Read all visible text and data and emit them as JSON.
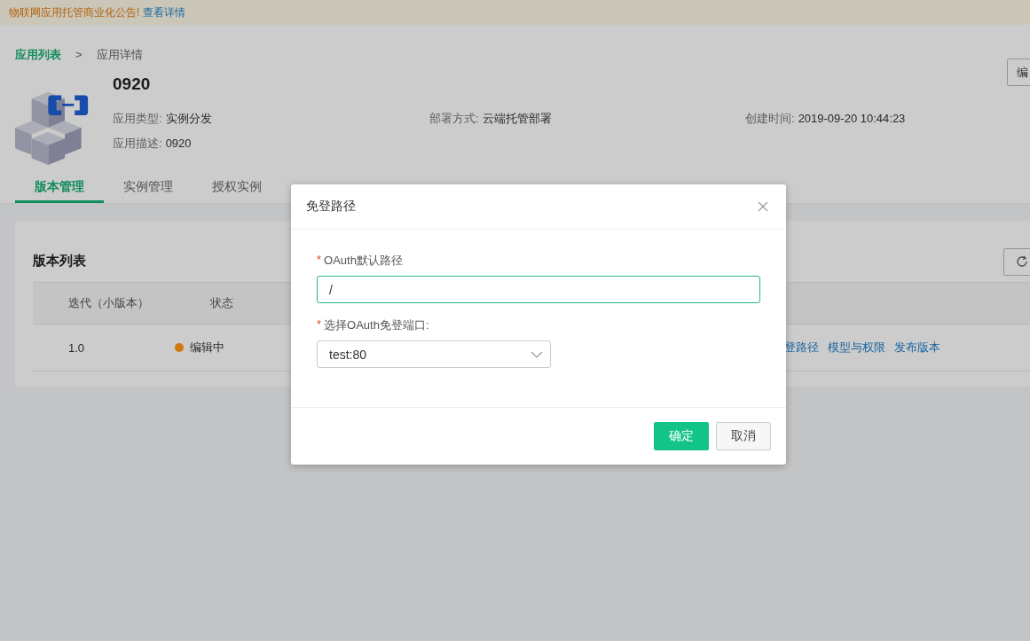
{
  "notice": {
    "text": "物联网应用托管商业化公告!",
    "link": "查看详情"
  },
  "breadcrumb": [
    {
      "label": "应用列表",
      "link": true
    },
    {
      "label": ">",
      "link": false
    },
    {
      "label": "应用详情",
      "link": false
    }
  ],
  "app": {
    "name": "0920",
    "edit_button": "编",
    "meta": [
      {
        "label": "应用类型:",
        "value": "实例分发"
      },
      {
        "label": "部署方式:",
        "value": "云端托管部署"
      },
      {
        "label": "创建时间:",
        "value": "2019-09-20 10:44:23"
      },
      {
        "label": "应用描述:",
        "value": "0920"
      }
    ]
  },
  "tabs": [
    {
      "label": "版本管理",
      "selected": true
    },
    {
      "label": "实例管理",
      "selected": false
    },
    {
      "label": "授权实例",
      "selected": false
    }
  ],
  "version_list": {
    "title": "版本列表",
    "columns": [
      "迭代（小版本）",
      "状态"
    ],
    "rows": [
      {
        "version": "1.0",
        "status": "编辑中",
        "color": "#d4770f",
        "actions": [
          "登路径",
          "模型与权限",
          "发布版本"
        ]
      }
    ]
  },
  "dialog": {
    "title": "免登路径",
    "fields": [
      {
        "kind": "input",
        "label": "OAuth默认路径",
        "required_mark": "*",
        "value": "/",
        "focused": true
      },
      {
        "kind": "select",
        "label": "选择OAuth免登端口:",
        "required_mark": "*",
        "value": "test:80",
        "focused": false
      }
    ],
    "buttons": [
      {
        "label": "确定",
        "primary": true
      },
      {
        "label": "取消",
        "primary": false
      }
    ]
  }
}
